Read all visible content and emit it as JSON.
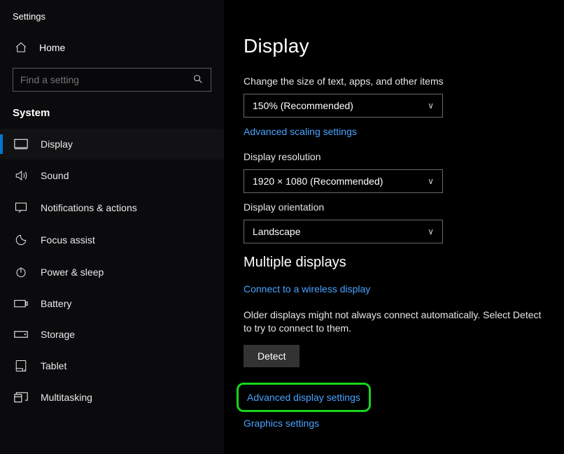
{
  "app": {
    "title": "Settings"
  },
  "sidebar": {
    "home_label": "Home",
    "search_placeholder": "Find a setting",
    "section_label": "System",
    "items": [
      {
        "label": "Display"
      },
      {
        "label": "Sound"
      },
      {
        "label": "Notifications & actions"
      },
      {
        "label": "Focus assist"
      },
      {
        "label": "Power & sleep"
      },
      {
        "label": "Battery"
      },
      {
        "label": "Storage"
      },
      {
        "label": "Tablet"
      },
      {
        "label": "Multitasking"
      }
    ]
  },
  "main": {
    "page_title": "Display",
    "scale": {
      "label": "Change the size of text, apps, and other items",
      "value": "150% (Recommended)",
      "link": "Advanced scaling settings"
    },
    "resolution": {
      "label": "Display resolution",
      "value": "1920 × 1080 (Recommended)"
    },
    "orientation": {
      "label": "Display orientation",
      "value": "Landscape"
    },
    "multi": {
      "heading": "Multiple displays",
      "wireless_link": "Connect to a wireless display",
      "detect_text": "Older displays might not always connect automatically. Select Detect to try to connect to them.",
      "detect_button": "Detect",
      "advanced_link": "Advanced display settings",
      "graphics_link": "Graphics settings"
    }
  }
}
